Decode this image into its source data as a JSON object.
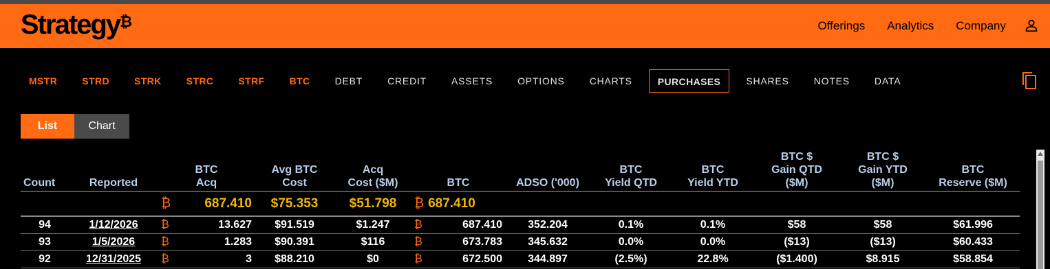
{
  "brand": {
    "logo_text": "Strategy",
    "logo_symbol": "₿",
    "accent": "#ff6a13"
  },
  "topnav": {
    "items": [
      "Offerings",
      "Analytics",
      "Company"
    ],
    "user_icon": "person-icon"
  },
  "subnav": {
    "tabs": [
      {
        "label": "MSTR",
        "style": "orange"
      },
      {
        "label": "STRD",
        "style": "orange"
      },
      {
        "label": "STRK",
        "style": "orange"
      },
      {
        "label": "STRC",
        "style": "orange"
      },
      {
        "label": "STRF",
        "style": "orange"
      },
      {
        "label": "BTC",
        "style": "orange"
      },
      {
        "label": "DEBT",
        "style": "plain"
      },
      {
        "label": "CREDIT",
        "style": "plain"
      },
      {
        "label": "ASSETS",
        "style": "plain"
      },
      {
        "label": "OPTIONS",
        "style": "plain"
      },
      {
        "label": "CHARTS",
        "style": "plain"
      },
      {
        "label": "PURCHASES",
        "style": "active"
      },
      {
        "label": "SHARES",
        "style": "plain"
      },
      {
        "label": "NOTES",
        "style": "plain"
      },
      {
        "label": "DATA",
        "style": "plain"
      }
    ],
    "copy_icon": "copy-icon"
  },
  "view_toggle": {
    "list_label": "List",
    "chart_label": "Chart",
    "selected": "List"
  },
  "table": {
    "headers": [
      "Count",
      "Reported",
      "BTC\nAcq",
      "Avg BTC\nCost",
      "Acq\nCost ($M)",
      "BTC",
      "ADSO ('000)",
      "BTC\nYield QTD",
      "BTC\nYield YTD",
      "BTC $\nGain QTD\n($M)",
      "BTC $\nGain YTD\n($M)",
      "BTC\nReserve ($M)"
    ],
    "totals": {
      "btc_acq": "687.410",
      "avg_cost": "$75.353",
      "acq_cost": "$51.798",
      "btc": "687.410"
    },
    "rows": [
      {
        "count": "94",
        "reported": "1/12/2026",
        "btc_acq": "13.627",
        "avg_cost": "$91.519",
        "acq_cost": "$1.247",
        "btc": "687.410",
        "adso": "352.204",
        "yield_qtd": "0.1%",
        "yield_ytd": "0.1%",
        "gain_qtd": "$58",
        "gain_ytd": "$58",
        "reserve": "$61.996"
      },
      {
        "count": "93",
        "reported": "1/5/2026",
        "btc_acq": "1.283",
        "avg_cost": "$90.391",
        "acq_cost": "$116",
        "btc": "673.783",
        "adso": "345.632",
        "yield_qtd": "0.0%",
        "yield_ytd": "0.0%",
        "gain_qtd": "($13)",
        "gain_ytd": "($13)",
        "reserve": "$60.433"
      },
      {
        "count": "92",
        "reported": "12/31/2025",
        "btc_acq": "3",
        "avg_cost": "$88.210",
        "acq_cost": "$0",
        "btc": "672.500",
        "adso": "344.897",
        "yield_qtd": "(2.5%)",
        "yield_ytd": "22.8%",
        "gain_qtd": "($1.400)",
        "gain_ytd": "$8.915",
        "reserve": "$58.854"
      }
    ]
  }
}
